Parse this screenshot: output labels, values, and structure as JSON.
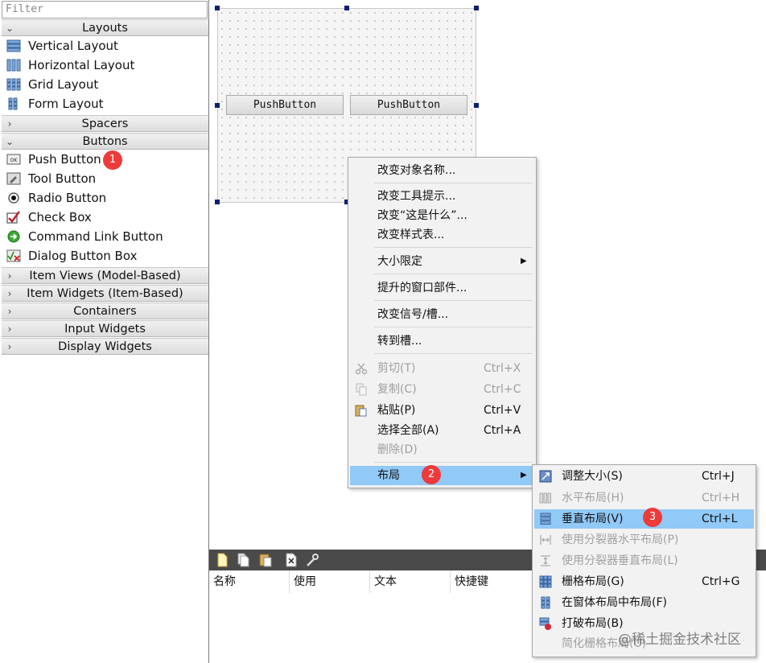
{
  "widgetbox": {
    "filter_placeholder": "Filter",
    "categories": {
      "layouts": "Layouts",
      "spacers": "Spacers",
      "buttons": "Buttons",
      "item_views": "Item Views (Model-Based)",
      "item_widgets": "Item Widgets (Item-Based)",
      "containers": "Containers",
      "input_widgets": "Input Widgets",
      "display_widgets": "Display Widgets"
    },
    "layout_items": [
      "Vertical Layout",
      "Horizontal Layout",
      "Grid Layout",
      "Form Layout"
    ],
    "button_items": [
      "Push Button",
      "Tool Button",
      "Radio Button",
      "Check Box",
      "Command Link Button",
      "Dialog Button Box"
    ]
  },
  "form": {
    "button1": "PushButton",
    "button2": "PushButton"
  },
  "context_menu": {
    "items": [
      {
        "label": "改变对象名称..."
      },
      {
        "label": "改变工具提示..."
      },
      {
        "label": "改变“这是什么”..."
      },
      {
        "label": "改变样式表..."
      },
      {
        "label": "大小限定"
      },
      {
        "label": "提升的窗口部件..."
      },
      {
        "label": "改变信号/槽..."
      },
      {
        "label": "转到槽..."
      },
      {
        "label": "剪切(T)",
        "shortcut": "Ctrl+X"
      },
      {
        "label": "复制(C)",
        "shortcut": "Ctrl+C"
      },
      {
        "label": "粘贴(P)",
        "shortcut": "Ctrl+V"
      },
      {
        "label": "选择全部(A)",
        "shortcut": "Ctrl+A"
      },
      {
        "label": "删除(D)"
      },
      {
        "label": "布局"
      }
    ]
  },
  "layout_submenu": {
    "items": [
      {
        "label": "调整大小(S)",
        "shortcut": "Ctrl+J"
      },
      {
        "label": "水平布局(H)",
        "shortcut": "Ctrl+H"
      },
      {
        "label": "垂直布局(V)",
        "shortcut": "Ctrl+L"
      },
      {
        "label": "使用分裂器水平布局(P)"
      },
      {
        "label": "使用分裂器垂直布局(L)"
      },
      {
        "label": "栅格布局(G)",
        "shortcut": "Ctrl+G"
      },
      {
        "label": "在窗体布局中布局(F)"
      },
      {
        "label": "打破布局(B)"
      },
      {
        "label": "简化栅格布局(U)"
      }
    ]
  },
  "action_editor": {
    "columns": [
      "名称",
      "使用",
      "文本",
      "快捷键"
    ]
  },
  "badges": [
    "1",
    "2",
    "3"
  ],
  "watermark": "@稀土掘金技术社区",
  "colors": {
    "highlight": "#91c9f7",
    "badge": "#ee3a3a",
    "menu_bg": "#f2f2f2",
    "action_bar": "#4a4a4a"
  }
}
